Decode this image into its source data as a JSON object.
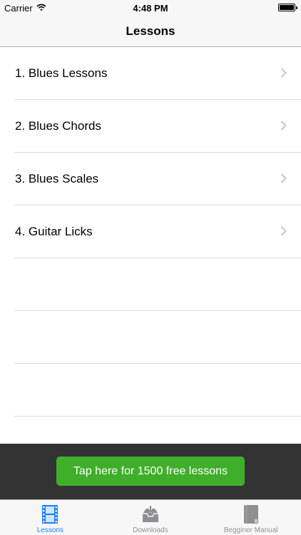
{
  "status_bar": {
    "carrier": "Carrier",
    "time": "4:48 PM"
  },
  "nav": {
    "title": "Lessons"
  },
  "lessons": [
    {
      "label": "1. Blues Lessons"
    },
    {
      "label": "2. Blues Chords"
    },
    {
      "label": "3. Blues Scales"
    },
    {
      "label": "4. Guitar Licks"
    }
  ],
  "ad": {
    "button_label": "Tap here for 1500 free lessons"
  },
  "tabs": [
    {
      "label": "Lessons",
      "icon": "film-icon",
      "active": true
    },
    {
      "label": "Downloads",
      "icon": "download-tray-icon",
      "active": false
    },
    {
      "label": "Begginer Manual",
      "icon": "book-icon",
      "active": false
    }
  ],
  "colors": {
    "accent": "#1a7ff6",
    "ad_button": "#3fae2a",
    "ad_bar": "#333333",
    "tab_inactive": "#929292"
  }
}
